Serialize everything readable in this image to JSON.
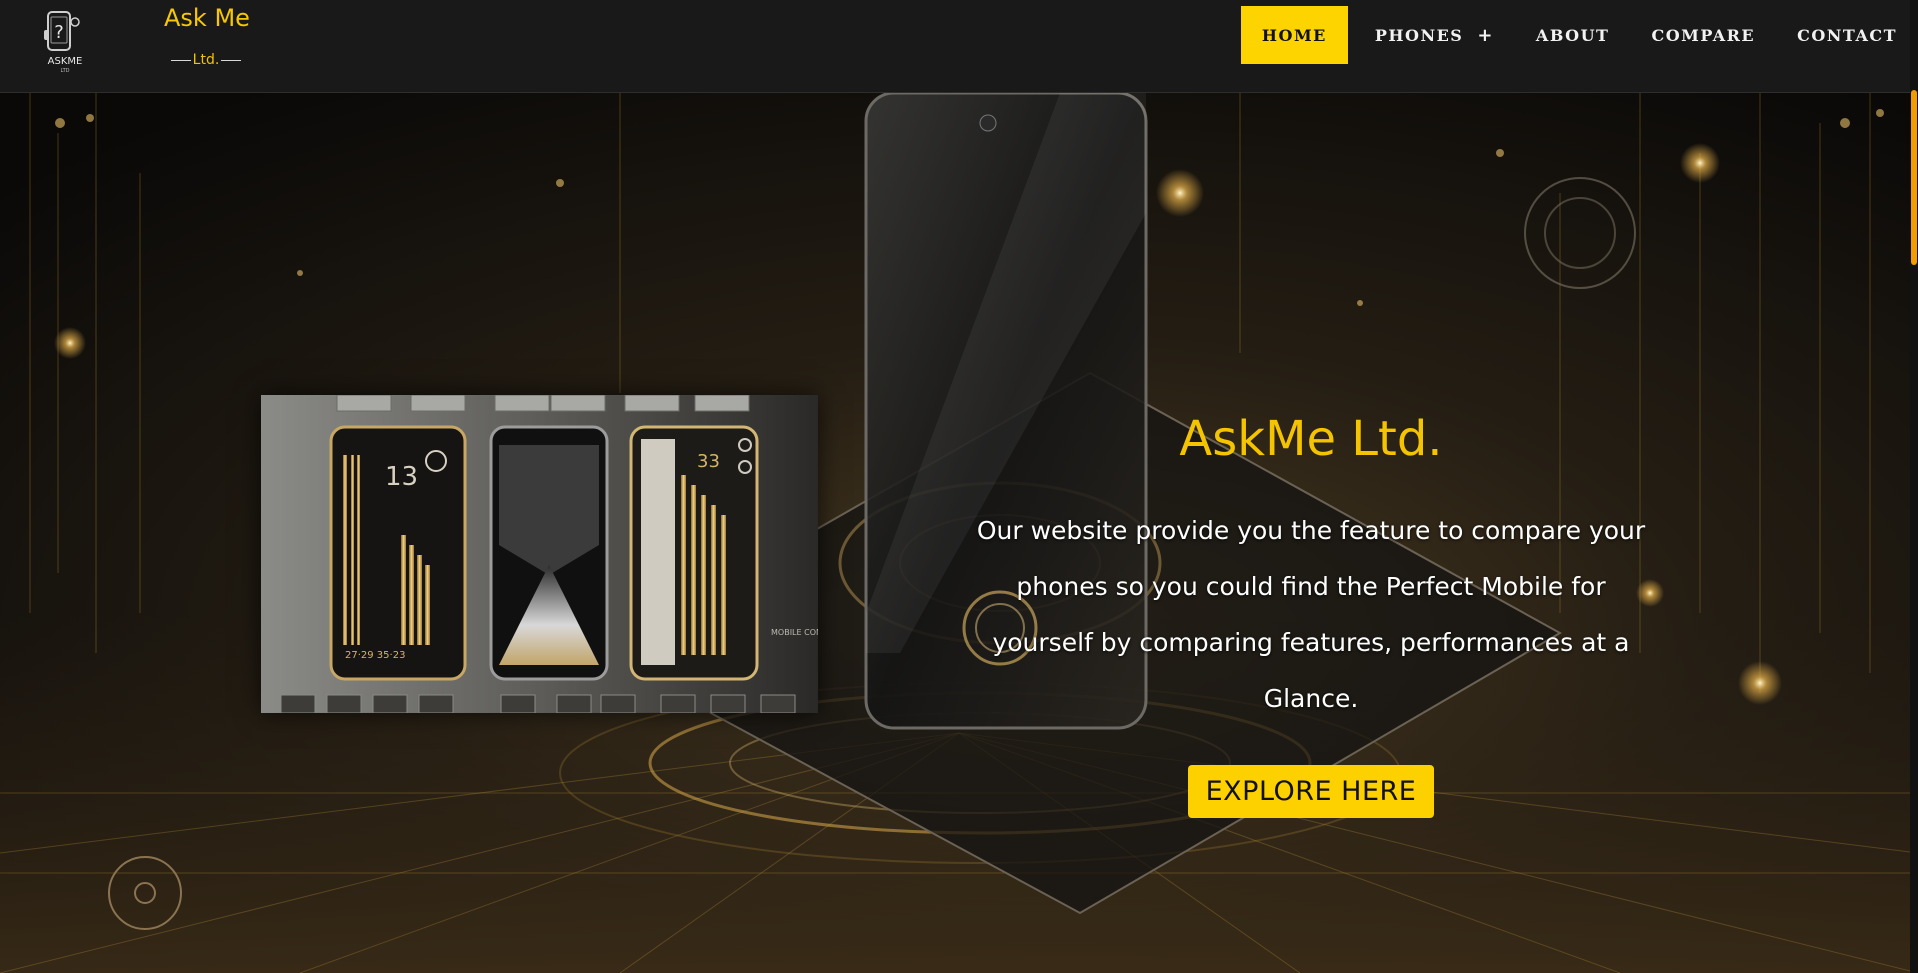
{
  "header": {
    "logo_text": "ASKME",
    "logo_sub": "LTD",
    "brand_name": "Ask Me",
    "brand_sub": "Ltd.",
    "nav": [
      {
        "label": "HOME",
        "active": true
      },
      {
        "label": "PHONES",
        "has_submenu": true,
        "submenu_icon": "+"
      },
      {
        "label": "ABOUT"
      },
      {
        "label": "COMPARE"
      },
      {
        "label": "CONTACT"
      }
    ]
  },
  "hero": {
    "title": "AskMe Ltd.",
    "description": "Our website provide you the feature to compare your phones so you could find the Perfect Mobile for yourself by comparing features, performances at a Glance.",
    "cta_label": "EXPLORE HERE",
    "showcase_caption": "MOBILE COMPARISON SECTION",
    "showcase_clock_1": "13",
    "showcase_clock_2": "33",
    "showcase_stats": "27·29   35·23"
  },
  "colors": {
    "accent": "#fdd400",
    "header_bg": "#191919",
    "scrollbar": "#f39c00"
  },
  "icons": {
    "logo": "phone-question-icon",
    "phones_submenu": "plus-icon"
  }
}
